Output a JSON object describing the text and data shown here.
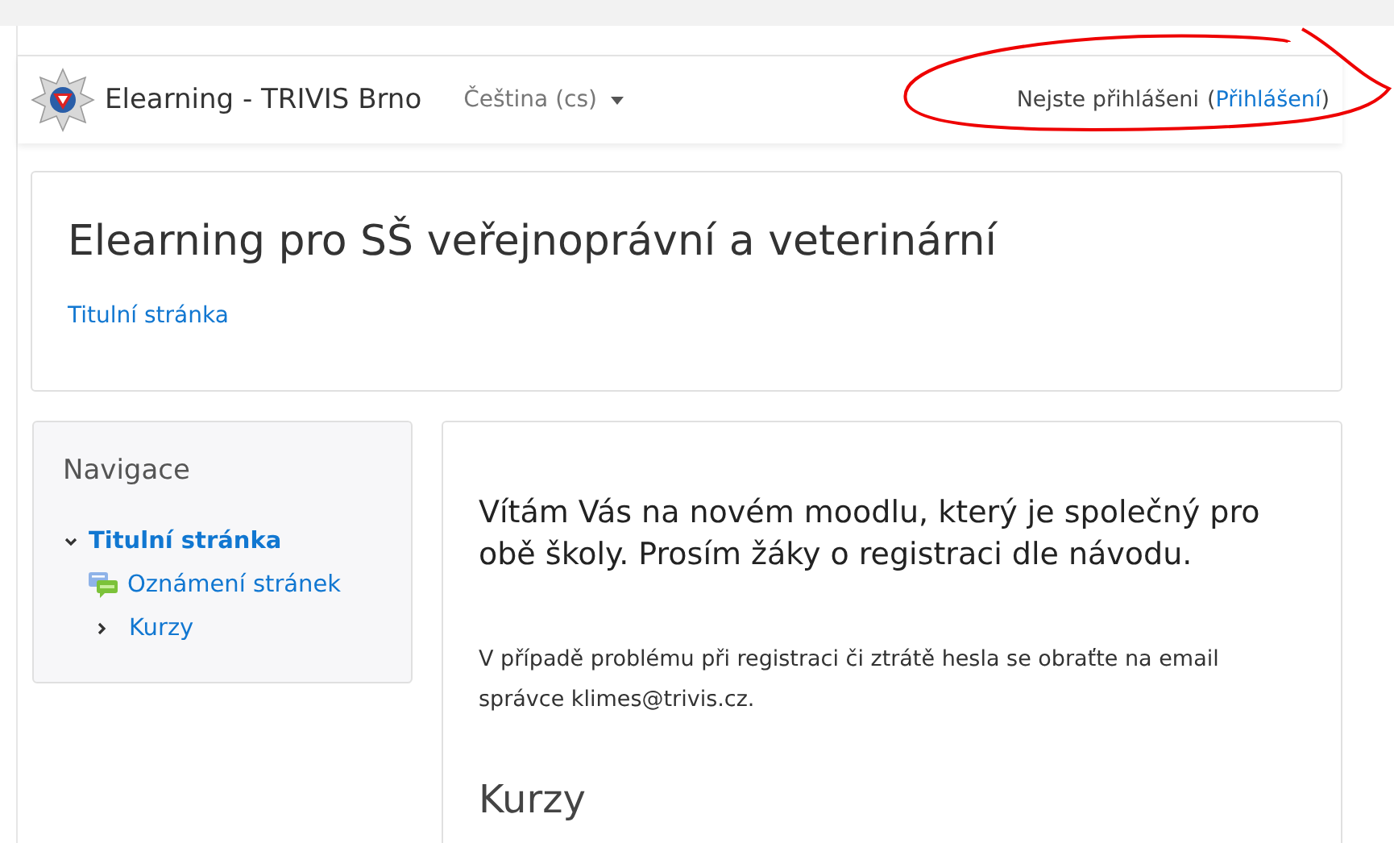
{
  "navbar": {
    "site_name": "Elearning - TRIVIS Brno",
    "language": "Čeština (cs)",
    "login_status": "Nejste přihlášeni",
    "open_paren": "(",
    "login_link": "Přihlášení",
    "close_paren": ")"
  },
  "header": {
    "title": "Elearning pro SŠ veřejnoprávní a veterinární",
    "breadcrumb": "Titulní stránka"
  },
  "navigation": {
    "title": "Navigace",
    "items": [
      {
        "label": "Titulní stránka",
        "kind": "branch",
        "expanded": true,
        "current": true,
        "children": [
          {
            "label": "Oznámení stránek",
            "kind": "forum",
            "current": false
          },
          {
            "label": "Kurzy",
            "kind": "branch",
            "expanded": false,
            "current": false
          }
        ]
      }
    ]
  },
  "main": {
    "welcome": "Vítám Vás na novém moodlu, který je společný pro obě školy. Prosím žáky o registraci dle návodu.",
    "contact": "V případě problému při registraci či ztrátě hesla se obraťte na email správce klimes@trivis.cz.",
    "courses_heading": "Kurzy"
  }
}
